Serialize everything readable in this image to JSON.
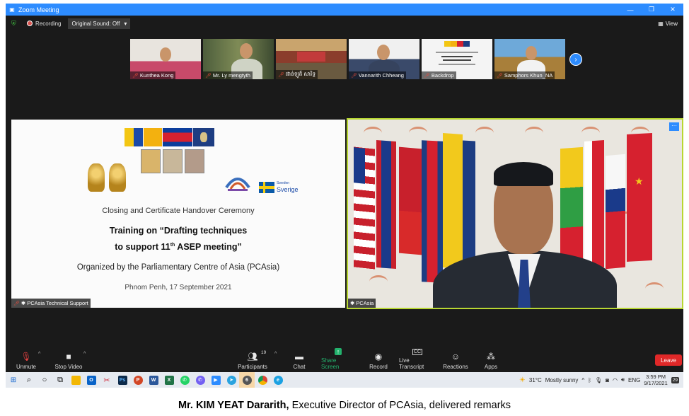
{
  "window": {
    "title": "Zoom Meeting",
    "controls": [
      "—",
      "❐",
      "✕"
    ],
    "logo_icon": "zoom-logo-icon"
  },
  "status_bar": {
    "recording_label": "Recording",
    "original_sound_label": "Original Sound: Off",
    "view_label": "View"
  },
  "participants_strip": [
    {
      "name": "Kunthea Kong",
      "muted": true
    },
    {
      "name": "Mr. Ly mengtyth",
      "muted": true
    },
    {
      "name": "ផាន់ឡូត៏ សារិទ្ធ",
      "muted": true
    },
    {
      "name": "Vannarith Chheang",
      "muted": true
    },
    {
      "name": "Backdrop",
      "muted": true
    },
    {
      "name": "Samphors Khun_NA",
      "muted": true
    }
  ],
  "shared_slide": {
    "owner_label": "PCAsia Technical Support",
    "sweden_small": "Sweden",
    "sweden_big": "Sverige",
    "line1": "Closing and Certificate Handover Ceremony",
    "line2": "Training on “Drafting techniques",
    "line3_pre": "to support 11",
    "line3_sup": "th",
    "line3_post": " ASEP meeting”",
    "line4": "Organized by the Parliamentary Centre of Asia (PCAsia)",
    "line5": "Phnom Penh, 17 September 2021"
  },
  "active_speaker": {
    "label": "PCAsia"
  },
  "toolbar": {
    "unmute": "Unmute",
    "stop_video": "Stop Video",
    "participants": "Participants",
    "participants_count": "19",
    "chat": "Chat",
    "share_screen": "Share Screen",
    "record": "Record",
    "live_transcript": "Live Transcript",
    "reactions": "Reactions",
    "apps": "Apps",
    "leave": "Leave"
  },
  "taskbar": {
    "zoom_badge": "6",
    "weather_temp": "31°C",
    "weather_text": "Mostly sunny",
    "language": "ENG",
    "time": "3:59 PM",
    "date": "9/17/2021",
    "notification_count": "29"
  },
  "caption": {
    "name": "Mr. KIM YEAT Dararith,",
    "rest": " Executive Director of PCAsia, delivered remarks"
  }
}
